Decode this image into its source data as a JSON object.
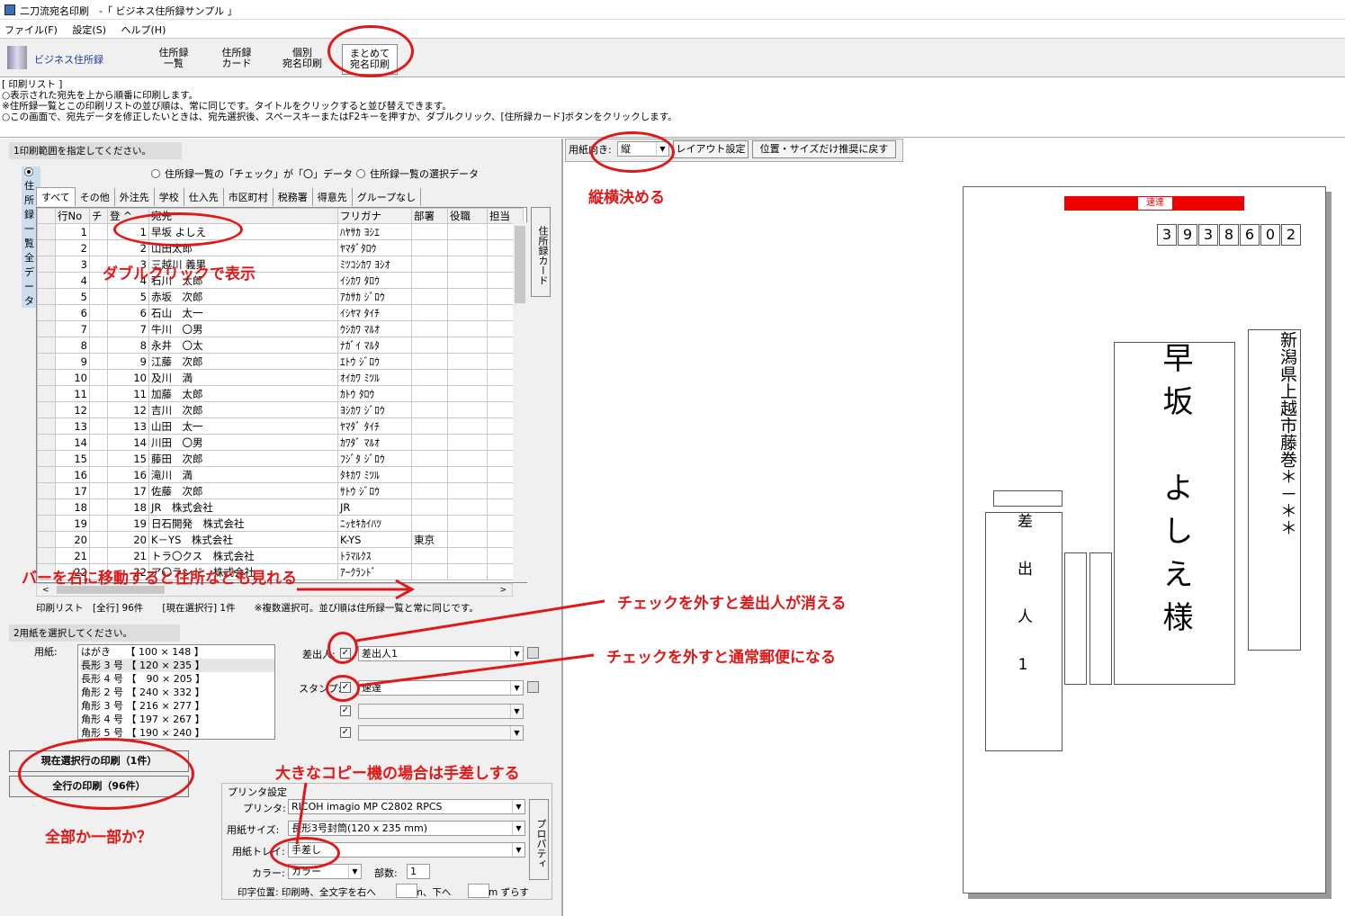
{
  "window": {
    "title": "二刀流宛名印刷　-「 ビジネス住所録サンプル 」"
  },
  "menu": [
    "ファイル(F)",
    "設定(S)",
    "ヘルプ(H)"
  ],
  "toolbar": {
    "logo": "ビジネス住所録",
    "buttons": [
      "住所録\n一覧",
      "住所録\nカード",
      "個別\n宛名印刷",
      "まとめて\n宛名印刷"
    ]
  },
  "info": {
    "lines": [
      "[ 印刷リスト ]",
      "○表示された宛先を上から順番に印刷します。",
      "※住所録一覧とこの印刷リストの並び順は、常に同じです。タイトルをクリックすると並び替えできます。",
      "○この画面で、宛先データを修正したいときは、宛先選択後、スペースキーまたはF2キーを押すか、ダブルクリック、[住所録カード]ボタンをクリックします。"
    ]
  },
  "range": {
    "label": "1印刷範囲を指定してください。",
    "options": [
      "住所録一覧全データ",
      "住所録一覧の「チェック」が「〇」データ",
      "住所録一覧の選択データ"
    ]
  },
  "tabs": [
    "すべて",
    "その他",
    "外注先",
    "学校",
    "仕入先",
    "市区町村",
    "税務署",
    "得意先",
    "グループなし"
  ],
  "grid": {
    "headers": [
      "",
      "行No",
      "チ",
      "登 ^",
      "宛先",
      "フリガナ",
      "部署",
      "役職",
      "担当"
    ],
    "rows": [
      [
        "1",
        "1",
        "早坂 よしえ",
        "ﾊﾔｻｶ ﾖｼｴ",
        ""
      ],
      [
        "2",
        "2",
        "山田太郎",
        "ﾔﾏﾀﾞﾀﾛｳ",
        ""
      ],
      [
        "3",
        "3",
        "三越川 義男",
        "ﾐﾂｺｼｶﾜ ﾖｼｵ",
        ""
      ],
      [
        "4",
        "4",
        "石川　太郎",
        "ｲｼｶﾜ ﾀﾛｳ",
        ""
      ],
      [
        "5",
        "5",
        "赤坂　次郎",
        "ｱｶｻｶ ｼﾞﾛｳ",
        ""
      ],
      [
        "6",
        "6",
        "石山　太一",
        "ｲｼﾔﾏ ﾀｲﾁ",
        ""
      ],
      [
        "7",
        "7",
        "牛川　〇男",
        "ｳｼｶﾜ ﾏﾙｵ",
        ""
      ],
      [
        "8",
        "8",
        "永井　〇太",
        "ﾅｶﾞｲ ﾏﾙﾀ",
        ""
      ],
      [
        "9",
        "9",
        "江藤　次郎",
        "ｴﾄｳ ｼﾞﾛｳ",
        ""
      ],
      [
        "10",
        "10",
        "及川　満",
        "ｵｲｶﾜ ﾐﾂﾙ",
        ""
      ],
      [
        "11",
        "11",
        "加藤　太郎",
        "ｶﾄｳ ﾀﾛｳ",
        ""
      ],
      [
        "12",
        "12",
        "吉川　次郎",
        "ﾖｼｶﾜ ｼﾞﾛｳ",
        ""
      ],
      [
        "13",
        "13",
        "山田　太一",
        "ﾔﾏﾀﾞ ﾀｲﾁ",
        ""
      ],
      [
        "14",
        "14",
        "川田　〇男",
        "ｶﾜﾀﾞ ﾏﾙｵ",
        ""
      ],
      [
        "15",
        "15",
        "藤田　次郎",
        "ﾌｼﾞﾀ ｼﾞﾛｳ",
        ""
      ],
      [
        "16",
        "16",
        "滝川　満",
        "ﾀｷｶﾜ ﾐﾂﾙ",
        ""
      ],
      [
        "17",
        "17",
        "佐藤　次郎",
        "ｻﾄｳ ｼﾞﾛｳ",
        ""
      ],
      [
        "18",
        "18",
        "JR　株式会社",
        "JR",
        ""
      ],
      [
        "19",
        "19",
        "日石開発　株式会社",
        "ﾆｯｾｷｶｲﾊﾂ",
        ""
      ],
      [
        "20",
        "20",
        "K－YS　株式会社",
        "K-YS",
        "東京"
      ],
      [
        "21",
        "21",
        "トラ〇クス　株式会社",
        "ﾄﾗﾏﾙｸｽ",
        ""
      ],
      [
        "22",
        "22",
        "ア〇ランド　株式会社",
        "ｱｰｸﾗﾝﾄﾞ",
        ""
      ]
    ],
    "side_button": "住所録カード"
  },
  "status": "印刷リスト　[全行] 96件　　[現在選択行] 1件　　※複数選択可。並び順は住所録一覧と常に同じです。",
  "paper": {
    "label": "2用紙を選択してください。",
    "field": "用紙:",
    "items": [
      "はがき　　【 100 × 148 】",
      "長形 3 号 【 120 × 235 】",
      "長形 4 号 【　90 × 205 】",
      "角形 2 号 【 240 × 332 】",
      "角形 3 号 【 216 × 277 】",
      "角形 4 号 【 197 × 267 】",
      "角形 5 号 【 190 × 240 】"
    ]
  },
  "options": {
    "sender_label": "差出人:",
    "sender_value": "差出人1",
    "stamp_label": "スタンプ:",
    "stamp_value": "速達"
  },
  "buttons": {
    "print_current": "現在選択行の印刷（1件）",
    "print_all": "全行の印刷（96件）"
  },
  "printer": {
    "group": "プリンタ設定",
    "printer_label": "プリンタ:",
    "printer_value": "RICOH imagio MP C2802 RPCS",
    "size_label": "用紙サイズ:",
    "size_value": "長形3号封筒(120 x 235 mm)",
    "tray_label": "用紙トレイ:",
    "tray_value": "手差し",
    "color_label": "カラー:",
    "color_value": "カラー",
    "copies_label": "部数:",
    "copies_value": "1",
    "props": "プロパティ",
    "offset": "印字位置: 印刷時、全文字を右へ　　　mm、下へ　　　mm ずらす"
  },
  "preview": {
    "orient_label": "用紙向き:",
    "orient_value": "縦",
    "layout_btn": "レイアウト設定",
    "reset_btn": "位置・サイズだけ推奨に戻す",
    "stamp": "速達",
    "zip": [
      "3",
      "9",
      "3",
      "8",
      "6",
      "0",
      "2"
    ],
    "name": "早坂　よしえ様",
    "address": "新潟県上越市藤巻＊－＊＊",
    "sender": "差出人1"
  },
  "annotations": {
    "a1": "ダブルクリックで表示",
    "a2": "バーを右に移動すると住所なども見れる",
    "a3": "チェックを外すと差出人が消える",
    "a4": "チェックを外すと通常郵便になる",
    "a5": "縦横決める",
    "a6": "大きなコピー機の場合は手差しする",
    "a7": "全部か一部か？"
  },
  "colors": {
    "annotation": "#e01818",
    "logo": "#1a3d9a"
  }
}
